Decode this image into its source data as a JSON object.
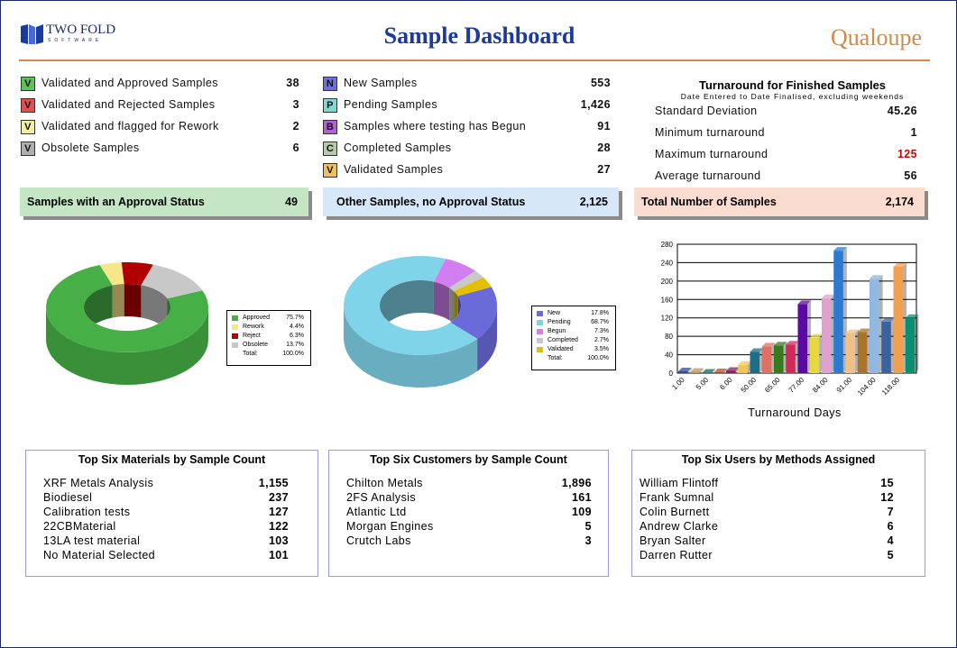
{
  "header": {
    "title": "Sample Dashboard",
    "logo_left": "TWO FOLD",
    "logo_left_sub": "SOFTWARE",
    "logo_right": "Qualoupe"
  },
  "approval": {
    "items": [
      {
        "icon": "V",
        "color": "#5cc25c",
        "label": "Validated and Approved Samples",
        "value": "38"
      },
      {
        "icon": "V",
        "color": "#e05050",
        "label": "Validated and Rejected Samples",
        "value": "3"
      },
      {
        "icon": "V",
        "color": "#f0f0a0",
        "label": "Validated and flagged for Rework",
        "value": "2"
      },
      {
        "icon": "V",
        "color": "#b0b0b0",
        "label": "Obsolete Samples",
        "value": "6"
      }
    ],
    "summary_label": "Samples with an Approval Status",
    "summary_value": "49"
  },
  "other": {
    "items": [
      {
        "icon": "N",
        "color": "#7070d8",
        "label": "New Samples",
        "value": "553"
      },
      {
        "icon": "P",
        "color": "#80d8d0",
        "label": "Pending Samples",
        "value": "1,426"
      },
      {
        "icon": "B",
        "color": "#b060d0",
        "label": "Samples where testing has Begun",
        "value": "91"
      },
      {
        "icon": "C",
        "color": "#b8c8a8",
        "label": "Completed Samples",
        "value": "28"
      },
      {
        "icon": "V",
        "color": "#f0c060",
        "label": "Validated Samples",
        "value": "27"
      }
    ],
    "summary_label": "Other Samples, no Approval Status",
    "summary_value": "2,125"
  },
  "turnaround": {
    "title": "Turnaround for Finished Samples",
    "subtitle": "Date Entered to Date Finalised, excluding weekends",
    "items": [
      {
        "label": "Standard Deviation",
        "value": "45.26"
      },
      {
        "label": "Minimum turnaround",
        "value": "1"
      },
      {
        "label": "Maximum turnaround",
        "value": "125",
        "color": "#d00000"
      },
      {
        "label": "Average turnaround",
        "value": "56"
      }
    ],
    "summary_label": "Total Number of Samples",
    "summary_value": "2,174"
  },
  "chart_data": [
    {
      "type": "pie",
      "style": "3d-donut",
      "slices": [
        {
          "name": "Approved",
          "value": 75.7,
          "label": "75.7%",
          "color": "#46b046"
        },
        {
          "name": "Rework",
          "value": 4.4,
          "label": "4.4%",
          "color": "#f8e68a"
        },
        {
          "name": "Reject",
          "value": 6.3,
          "label": "6.3%",
          "color": "#b00000"
        },
        {
          "name": "Obsolete",
          "value": 13.7,
          "label": "13.7%",
          "color": "#c8c8c8"
        }
      ],
      "total_label": "Total:",
      "total_value": "100.0%",
      "legend": "right"
    },
    {
      "type": "pie",
      "style": "3d-donut",
      "slices": [
        {
          "name": "New",
          "value": 17.8,
          "label": "17.8%",
          "color": "#6a6ad8"
        },
        {
          "name": "Pending",
          "value": 68.7,
          "label": "68.7%",
          "color": "#80d4ea"
        },
        {
          "name": "Begun",
          "value": 7.3,
          "label": "7.3%",
          "color": "#d27ef0"
        },
        {
          "name": "Completed",
          "value": 2.7,
          "label": "2.7%",
          "color": "#c8c8c8"
        },
        {
          "name": "Validated",
          "value": 3.5,
          "label": "3.5%",
          "color": "#e0c000"
        }
      ],
      "total_label": "Total:",
      "total_value": "100.0%",
      "legend": "right"
    },
    {
      "type": "bar",
      "style": "3d",
      "xlabel": "Turnaround Days",
      "ylim": [
        0,
        280
      ],
      "yticks": [
        0,
        40,
        80,
        120,
        160,
        200,
        240,
        280
      ],
      "grid": true,
      "categories": [
        "1.00",
        "",
        "5.00",
        "",
        "6.00",
        "",
        "50.00",
        "",
        "65.00",
        "",
        "77.00",
        "",
        "84.00",
        "",
        "91.00",
        "",
        "104.00",
        "",
        "118.00",
        ""
      ],
      "values": [
        4,
        3,
        1,
        2,
        5,
        18,
        46,
        58,
        60,
        62,
        150,
        77,
        163,
        266,
        87,
        89,
        205,
        112,
        231,
        120
      ],
      "colors": [
        "#2d4f8a",
        "#c8935a",
        "#0f6e5a",
        "#c04a1e",
        "#8a1e5a",
        "#f0c850",
        "#1e6e8a",
        "#e07060",
        "#3a7a1e",
        "#d02a5a",
        "#5a0aa0",
        "#e8d840",
        "#e0a0d0",
        "#2c7ad0",
        "#f0c088",
        "#a8742a",
        "#90b8e0",
        "#3a62a0",
        "#f0a050",
        "#0a9070"
      ]
    }
  ],
  "tables": [
    {
      "title": "Top Six Materials by Sample Count",
      "items": [
        {
          "label": "XRF Metals Analysis",
          "value": "1,155"
        },
        {
          "label": "Biodiesel",
          "value": "237"
        },
        {
          "label": "Calibration tests",
          "value": "127"
        },
        {
          "label": "22CBMaterial",
          "value": "122"
        },
        {
          "label": "13LA test material",
          "value": "103"
        },
        {
          "label": "No Material Selected",
          "value": "101"
        }
      ]
    },
    {
      "title": "Top Six Customers by Sample Count",
      "items": [
        {
          "label": "Chilton Metals",
          "value": "1,896"
        },
        {
          "label": "2FS Analysis",
          "value": "161"
        },
        {
          "label": "Atlantic Ltd",
          "value": "109"
        },
        {
          "label": "Morgan Engines",
          "value": "5"
        },
        {
          "label": "Crutch Labs",
          "value": "3"
        }
      ]
    },
    {
      "title": "Top Six Users by Methods Assigned",
      "items": [
        {
          "label": "William Flintoff",
          "value": "15"
        },
        {
          "label": "Frank Sumnal",
          "value": "12"
        },
        {
          "label": "Colin Burnett",
          "value": "7"
        },
        {
          "label": "Andrew Clarke",
          "value": "6"
        },
        {
          "label": "Bryan Salter",
          "value": "4"
        },
        {
          "label": "Darren Rutter",
          "value": "5"
        }
      ]
    }
  ]
}
